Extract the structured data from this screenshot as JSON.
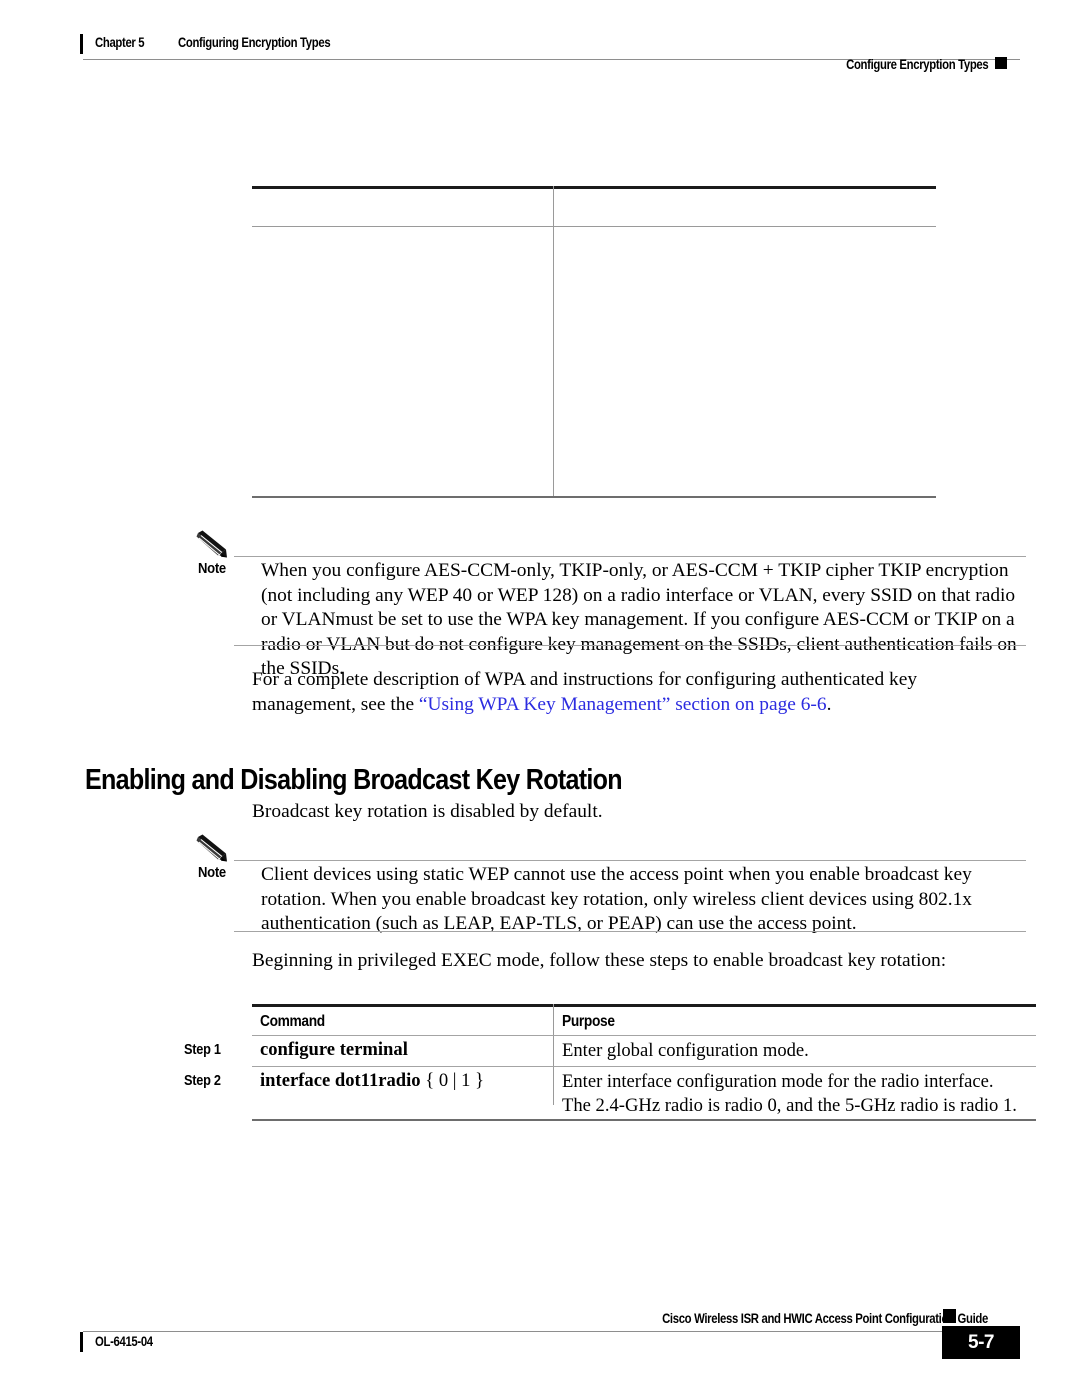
{
  "header": {
    "chapter_label": "Chapter 5",
    "chapter_title": "Configuring Encryption Types",
    "section_title": "Configure Encryption Types"
  },
  "notes": [
    {
      "label": "Note",
      "text": "When you configure AES-CCM-only, TKIP-only, or AES-CCM + TKIP cipher TKIP encryption (not including any WEP 40 or WEP 128) on a radio interface or VLAN, every SSID on that radio or VLANmust be set to use the WPA key management. If you configure AES-CCM or TKIP on a radio or VLAN but do not configure key management on the SSIDs, client authentication fails on the SSIDs."
    },
    {
      "label": "Note",
      "text": "Client devices using static WEP cannot use the access point when you enable broadcast key rotation. When you enable broadcast key rotation, only wireless client devices using 802.1x authentication (such as LEAP, EAP-TLS, or PEAP) can use the access point."
    }
  ],
  "paragraphs": {
    "wpa_reference_lead": "For a complete description of WPA and instructions for configuring authenticated key management, see the ",
    "wpa_reference_link": "“Using WPA Key Management” section on page 6-6",
    "wpa_reference_tail": ".",
    "broadcast_default": "Broadcast key rotation is disabled by default.",
    "steps_intro": "Beginning in privileged EXEC mode, follow these steps to enable broadcast key rotation:"
  },
  "section_heading": "Enabling and Disabling Broadcast Key Rotation",
  "steps_table": {
    "columns": [
      "Command",
      "Purpose"
    ],
    "rows": [
      {
        "step": "Step 1",
        "command": "configure terminal",
        "command_arg": "",
        "purpose": "Enter global configuration mode."
      },
      {
        "step": "Step 2",
        "command": "interface dot11radio ",
        "command_arg": "{ 0 | 1 }",
        "purpose": "Enter interface configuration mode for the radio interface. The 2.4-GHz radio is radio 0, and the 5-GHz radio is radio 1."
      }
    ]
  },
  "footer": {
    "guide_title": "Cisco Wireless ISR and HWIC Access Point Configuration Guide",
    "doc_id": "OL-6415-04",
    "page_number": "5-7"
  },
  "colors": {
    "link": "#2c2ce0",
    "rule": "#a4a4a4",
    "rule_heavy": "#1b1b1b"
  }
}
